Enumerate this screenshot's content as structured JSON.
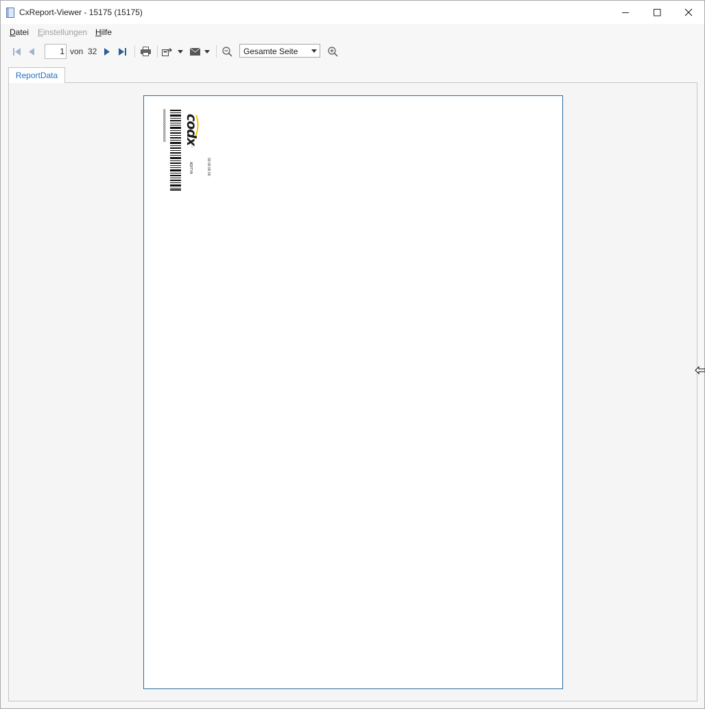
{
  "window": {
    "title": "CxReport-Viewer - 15175 (15175)"
  },
  "menu": {
    "items": [
      {
        "label": "Datei",
        "accel": "D",
        "rest": "atei",
        "enabled": true
      },
      {
        "label": "Einstellungen",
        "accel": "E",
        "rest": "instellungen",
        "enabled": false
      },
      {
        "label": "Hilfe",
        "accel": "H",
        "rest": "ilfe",
        "enabled": true
      }
    ]
  },
  "toolbar": {
    "current_page": "1",
    "of_label": "von",
    "total_pages": "32",
    "zoom_value": "Gesamte Seite",
    "icons": [
      "first-page-icon",
      "previous-page-icon",
      "next-page-icon",
      "last-page-icon",
      "print-icon",
      "export-icon",
      "email-icon",
      "zoom-out-icon",
      "zoom-in-icon"
    ]
  },
  "tabs": [
    {
      "label": "ReportData",
      "active": true
    }
  ],
  "report_page": {
    "barcode_digits": "0000000000000000",
    "logo_text": "codx",
    "sender_text": "ADITYA",
    "phone_text": "00 00 00 00"
  },
  "colors": {
    "accent": "#1e73be",
    "nav_icon": "#2a5f99",
    "disabled_nav": "#9fb4cf",
    "page_border": "#2a6e99",
    "logo_accent": "#f5c400"
  }
}
